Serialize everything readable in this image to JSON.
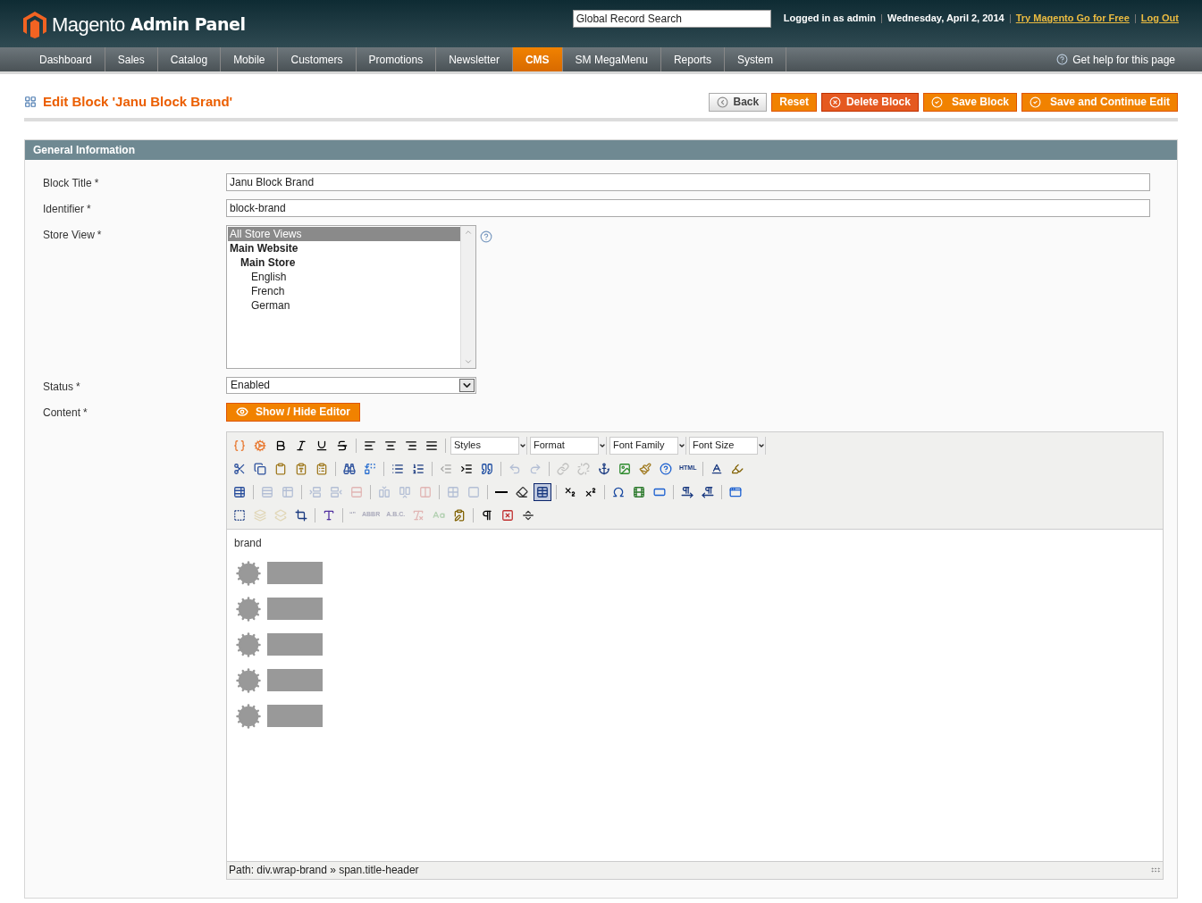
{
  "header": {
    "logo": {
      "brand": "Magento",
      "suffix": "Admin Panel"
    },
    "search": {
      "value": "Global Record Search"
    },
    "user": "Logged in as admin",
    "date": "Wednesday, April 2, 2014",
    "links": [
      "Try Magento Go for Free",
      "Log Out"
    ]
  },
  "nav": {
    "items": [
      {
        "label": "Dashboard",
        "selected": false
      },
      {
        "label": "Sales",
        "selected": false
      },
      {
        "label": "Catalog",
        "selected": false
      },
      {
        "label": "Mobile",
        "selected": false
      },
      {
        "label": "Customers",
        "selected": false
      },
      {
        "label": "Promotions",
        "selected": false
      },
      {
        "label": "Newsletter",
        "selected": false
      },
      {
        "label": "CMS",
        "selected": true
      },
      {
        "label": "SM MegaMenu",
        "selected": false
      },
      {
        "label": "Reports",
        "selected": false
      },
      {
        "label": "System",
        "selected": false
      }
    ],
    "help": "Get help for this page"
  },
  "page": {
    "title": "Edit Block 'Janu Block Brand'",
    "buttons": [
      {
        "label": "Back",
        "kind": "back"
      },
      {
        "label": "Reset",
        "kind": "plain"
      },
      {
        "label": "Delete Block",
        "kind": "delete"
      },
      {
        "label": "Save Block",
        "kind": "save"
      },
      {
        "label": "Save and Continue Edit",
        "kind": "save"
      }
    ]
  },
  "section": {
    "title": "General Information",
    "fields": [
      {
        "label": "Block Title",
        "required_mark": "*",
        "kind": "text",
        "value": "Janu Block Brand"
      },
      {
        "label": "Identifier",
        "required_mark": "*",
        "kind": "text",
        "value": "block-brand"
      },
      {
        "label": "Store View",
        "required_mark": "*",
        "kind": "multiselect",
        "options": [
          {
            "label": "All Store Views",
            "selected": true,
            "bold": false
          },
          {
            "label": "Main Website",
            "selected": false,
            "bold": true,
            "children": [
              {
                "label": "Main Store",
                "selected": false,
                "bold": true,
                "children": [
                  {
                    "label": "English",
                    "selected": false,
                    "bold": false
                  },
                  {
                    "label": "French",
                    "selected": false,
                    "bold": false
                  },
                  {
                    "label": "German",
                    "selected": false,
                    "bold": false
                  }
                ]
              }
            ]
          }
        ]
      },
      {
        "label": "Status",
        "required_mark": "*",
        "kind": "select",
        "value": "Enabled"
      },
      {
        "label": "Content",
        "required_mark": "*",
        "kind": "editor",
        "button": "Show / Hide Editor"
      }
    ]
  },
  "editor": {
    "toolbar": [
      [
        {
          "kind": "button",
          "disabled": false,
          "selected": false
        },
        {
          "kind": "button",
          "disabled": false,
          "selected": false
        },
        {
          "kind": "button",
          "disabled": false,
          "selected": false
        },
        {
          "kind": "button",
          "disabled": false,
          "selected": false
        },
        {
          "kind": "button",
          "disabled": false,
          "selected": false
        },
        {
          "kind": "button",
          "disabled": false,
          "selected": false
        },
        {
          "kind": "sep"
        },
        {
          "kind": "button",
          "disabled": false,
          "selected": false
        },
        {
          "kind": "button",
          "disabled": false,
          "selected": false
        },
        {
          "kind": "button",
          "disabled": false,
          "selected": false
        },
        {
          "kind": "button",
          "disabled": false,
          "selected": false
        },
        {
          "kind": "sep"
        },
        {
          "kind": "select",
          "label": "Styles"
        },
        {
          "kind": "select",
          "label": "Format"
        },
        {
          "kind": "select",
          "label": "Font Family"
        },
        {
          "kind": "select",
          "label": "Font Size"
        }
      ],
      [
        {
          "kind": "button",
          "disabled": false,
          "selected": false
        },
        {
          "kind": "button",
          "disabled": false,
          "selected": false
        },
        {
          "kind": "button",
          "disabled": false,
          "selected": false
        },
        {
          "kind": "button",
          "disabled": false,
          "selected": false
        },
        {
          "kind": "button",
          "disabled": false,
          "selected": false
        },
        {
          "kind": "sep"
        },
        {
          "kind": "button",
          "disabled": false,
          "selected": false
        },
        {
          "kind": "button",
          "disabled": false,
          "selected": false
        },
        {
          "kind": "sep"
        },
        {
          "kind": "button",
          "disabled": false,
          "selected": false
        },
        {
          "kind": "button",
          "disabled": false,
          "selected": false
        },
        {
          "kind": "sep"
        },
        {
          "kind": "button",
          "disabled": true,
          "selected": false
        },
        {
          "kind": "button",
          "disabled": false,
          "selected": false
        },
        {
          "kind": "button",
          "disabled": false,
          "selected": false
        },
        {
          "kind": "sep"
        },
        {
          "kind": "button",
          "disabled": true,
          "selected": false
        },
        {
          "kind": "button",
          "disabled": true,
          "selected": false
        },
        {
          "kind": "sep"
        },
        {
          "kind": "button",
          "disabled": true,
          "selected": false
        },
        {
          "kind": "button",
          "disabled": true,
          "selected": false
        },
        {
          "kind": "button",
          "disabled": false,
          "selected": false
        },
        {
          "kind": "button",
          "disabled": false,
          "selected": false
        },
        {
          "kind": "button",
          "disabled": false,
          "selected": false
        },
        {
          "kind": "button",
          "disabled": false,
          "selected": false
        },
        {
          "kind": "glyph",
          "text": "HTML",
          "disabled": false
        },
        {
          "kind": "sep"
        },
        {
          "kind": "button",
          "disabled": false,
          "selected": false
        },
        {
          "kind": "button",
          "disabled": false,
          "selected": false
        }
      ],
      [
        {
          "kind": "button",
          "disabled": false,
          "selected": false
        },
        {
          "kind": "sep"
        },
        {
          "kind": "button",
          "disabled": true,
          "selected": false
        },
        {
          "kind": "button",
          "disabled": true,
          "selected": false
        },
        {
          "kind": "sep"
        },
        {
          "kind": "button",
          "disabled": true,
          "selected": false
        },
        {
          "kind": "button",
          "disabled": true,
          "selected": false
        },
        {
          "kind": "button",
          "disabled": true,
          "selected": false
        },
        {
          "kind": "sep"
        },
        {
          "kind": "button",
          "disabled": true,
          "selected": false
        },
        {
          "kind": "button",
          "disabled": true,
          "selected": false
        },
        {
          "kind": "button",
          "disabled": true,
          "selected": false
        },
        {
          "kind": "sep"
        },
        {
          "kind": "button",
          "disabled": true,
          "selected": false
        },
        {
          "kind": "button",
          "disabled": true,
          "selected": false
        },
        {
          "kind": "sep"
        },
        {
          "kind": "button",
          "disabled": false,
          "selected": false
        },
        {
          "kind": "button",
          "disabled": false,
          "selected": false
        },
        {
          "kind": "button",
          "disabled": false,
          "selected": true
        },
        {
          "kind": "sep"
        },
        {
          "kind": "button",
          "disabled": false,
          "selected": false
        },
        {
          "kind": "button",
          "disabled": false,
          "selected": false
        },
        {
          "kind": "sep"
        },
        {
          "kind": "button",
          "disabled": false,
          "selected": false
        },
        {
          "kind": "button",
          "disabled": false,
          "selected": false
        },
        {
          "kind": "button",
          "disabled": false,
          "selected": false
        },
        {
          "kind": "sep"
        },
        {
          "kind": "button",
          "disabled": false,
          "selected": false
        },
        {
          "kind": "button",
          "disabled": false,
          "selected": false
        },
        {
          "kind": "sep"
        },
        {
          "kind": "button",
          "disabled": false,
          "selected": false
        }
      ],
      [
        {
          "kind": "button",
          "disabled": false,
          "selected": false
        },
        {
          "kind": "button",
          "disabled": true,
          "selected": false
        },
        {
          "kind": "button",
          "disabled": true,
          "selected": false
        },
        {
          "kind": "button",
          "disabled": false,
          "selected": false
        },
        {
          "kind": "sep"
        },
        {
          "kind": "button",
          "disabled": false,
          "selected": false
        },
        {
          "kind": "sep"
        },
        {
          "kind": "glyph",
          "text": "“”",
          "disabled": true
        },
        {
          "kind": "glyph",
          "text": "ABBR",
          "disabled": true
        },
        {
          "kind": "glyph",
          "text": "A.B.C.",
          "disabled": true
        },
        {
          "kind": "button",
          "disabled": true,
          "selected": false
        },
        {
          "kind": "button",
          "disabled": true,
          "selected": false
        },
        {
          "kind": "button",
          "disabled": false,
          "selected": false
        },
        {
          "kind": "sep"
        },
        {
          "kind": "button",
          "disabled": false,
          "selected": false
        },
        {
          "kind": "button",
          "disabled": false,
          "selected": false
        },
        {
          "kind": "button",
          "disabled": false,
          "selected": false
        }
      ]
    ],
    "content": {
      "text": "brand",
      "images": [
        {
          "kind": "image"
        },
        {
          "kind": "image"
        },
        {
          "kind": "image"
        },
        {
          "kind": "image"
        },
        {
          "kind": "image"
        }
      ]
    },
    "path": "Path: div.wrap-brand » span.title-header"
  }
}
